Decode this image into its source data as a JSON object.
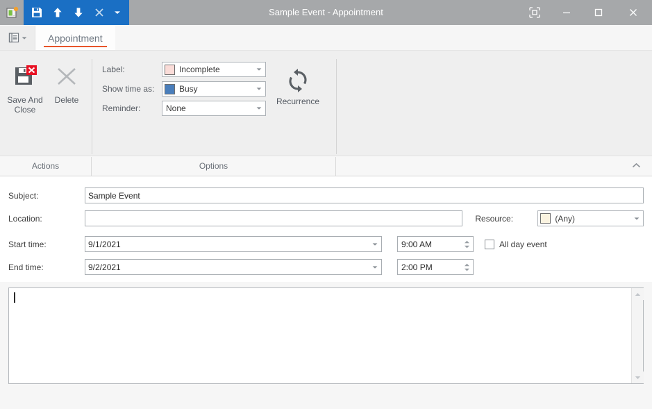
{
  "window": {
    "title": "Sample Event - Appointment",
    "accent_blue": "#1a6fc4",
    "titlebar_bg": "#a6a8aa",
    "tab_underline": "#e8542a"
  },
  "quick_access": {
    "items": [
      {
        "name": "save-button",
        "icon": "save-icon"
      },
      {
        "name": "previous-button",
        "icon": "arrow-up-icon"
      },
      {
        "name": "next-button",
        "icon": "arrow-down-icon"
      },
      {
        "name": "delete-button",
        "icon": "close-x-icon"
      },
      {
        "name": "customize-button",
        "icon": "chevron-down-icon"
      }
    ]
  },
  "window_controls": {
    "ribbon_display": "ribbon-display-options-icon",
    "minimize": "minimize-icon",
    "maximize": "maximize-icon",
    "close": "close-icon"
  },
  "tabs": {
    "file_menu": "file-menu-icon",
    "items": [
      {
        "label": "Appointment",
        "active": true
      }
    ]
  },
  "ribbon": {
    "groups": [
      {
        "name": "actions",
        "label": "Actions",
        "buttons": [
          {
            "label": "Save And\nClose",
            "line1": "Save And",
            "line2": "Close",
            "icon": "save-and-close-icon"
          },
          {
            "label": "Delete",
            "line1": "Delete",
            "line2": "",
            "icon": "delete-x-icon"
          }
        ]
      },
      {
        "name": "options",
        "label": "Options",
        "fields": [
          {
            "label": "Label:",
            "value": "Incomplete",
            "swatch": "#fadcd8",
            "has_swatch": true
          },
          {
            "label": "Show time as:",
            "value": "Busy",
            "swatch": "#4a7ebb",
            "has_swatch": true
          },
          {
            "label": "Reminder:",
            "value": "None",
            "swatch": "",
            "has_swatch": false
          }
        ],
        "recurrence": {
          "label": "Recurrence",
          "icon": "recurrence-icon"
        }
      }
    ],
    "collapse_icon": "chevron-up-icon"
  },
  "form": {
    "subject": {
      "label": "Subject:",
      "value": "Sample Event",
      "placeholder": ""
    },
    "location": {
      "label": "Location:",
      "value": "",
      "placeholder": ""
    },
    "resource": {
      "label": "Resource:",
      "value": "(Any)",
      "swatch": "#faf3e0"
    },
    "start": {
      "label": "Start time:",
      "date": "9/1/2021",
      "time": "9:00 AM"
    },
    "end": {
      "label": "End time:",
      "date": "9/2/2021",
      "time": "2:00 PM"
    },
    "all_day": {
      "label": "All day event",
      "checked": false
    }
  },
  "notes": {
    "value": "",
    "placeholder": "",
    "scroll_up": "scroll-up-icon",
    "scroll_down": "scroll-down-icon"
  }
}
